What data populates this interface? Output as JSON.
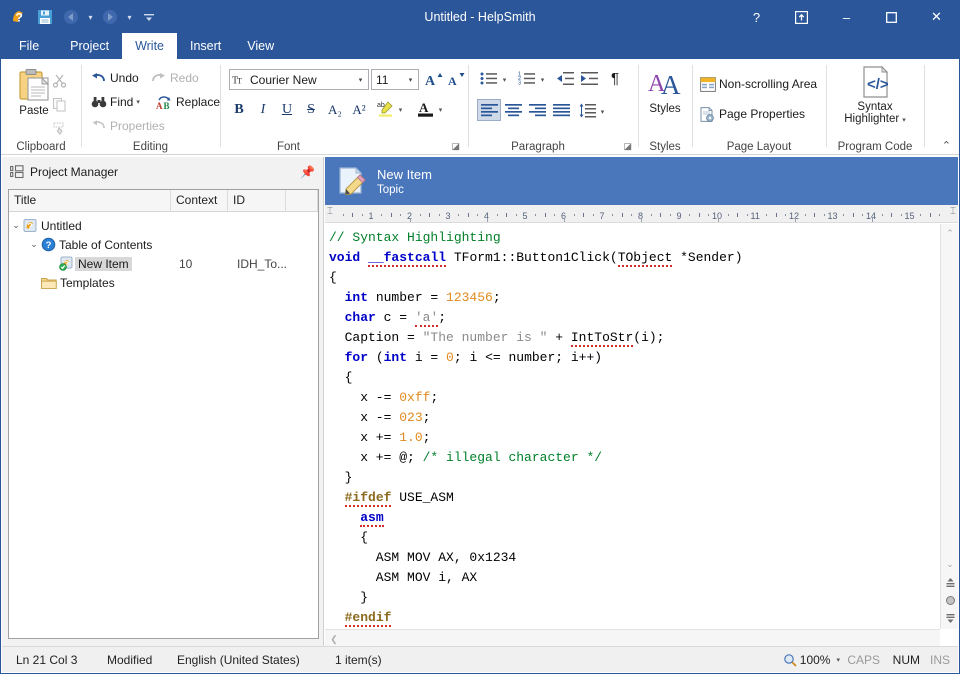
{
  "window": {
    "title": "Untitled - HelpSmith",
    "quick_access": [
      {
        "name": "app-icon",
        "label": "HelpSmith"
      },
      {
        "name": "save-icon",
        "label": "Save"
      },
      {
        "name": "undo-icon",
        "label": "Undo"
      },
      {
        "name": "redo-icon",
        "label": "Redo"
      },
      {
        "name": "customize-qat-icon",
        "label": "Customize Quick Access Toolbar"
      }
    ],
    "controls": [
      {
        "name": "help-button",
        "glyph": "?"
      },
      {
        "name": "ribbon-display-options-button",
        "glyph": "⬒"
      },
      {
        "name": "minimize-button",
        "glyph": "–"
      },
      {
        "name": "maximize-button",
        "glyph": "☐"
      },
      {
        "name": "close-button",
        "glyph": "✕"
      }
    ],
    "accent_color": "#2b579a",
    "header_band_color": "#4a77bb"
  },
  "ribbon": {
    "tabs": [
      {
        "label": "File",
        "active": false
      },
      {
        "label": "Project",
        "active": false
      },
      {
        "label": "Write",
        "active": true
      },
      {
        "label": "Insert",
        "active": false
      },
      {
        "label": "View",
        "active": false
      }
    ],
    "collapse_label": "Collapse the Ribbon",
    "groups": {
      "clipboard": {
        "label": "Clipboard",
        "paste_label": "Paste",
        "cut_label": "Cut",
        "copy_label": "Copy",
        "format_painter_label": "Format Painter"
      },
      "editing": {
        "label": "Editing",
        "undo_label": "Undo",
        "redo_label": "Redo",
        "find_label": "Find",
        "replace_label": "Replace",
        "properties_label": "Properties"
      },
      "font": {
        "label": "Font",
        "font_family_value": "Courier New",
        "font_size_value": "11",
        "grow_font_label": "Grow Font",
        "shrink_font_label": "Shrink Font",
        "bold_label": "B",
        "italic_label": "I",
        "underline_label": "U",
        "strikethrough_label": "S",
        "subscript_label": "A₂",
        "superscript_label": "A²",
        "highlight_label": "Text Highlight Color",
        "font_color_label": "Font Color"
      },
      "paragraph": {
        "label": "Paragraph",
        "bullets_label": "Bullets",
        "numbering_label": "Numbering",
        "decrease_indent_label": "Decrease Indent",
        "increase_indent_label": "Increase Indent",
        "show_marks_label": "Show Formatting Marks",
        "align_left_label": "Align Left",
        "align_center_label": "Center",
        "align_right_label": "Align Right",
        "justify_label": "Justify",
        "line_spacing_label": "Line Spacing"
      },
      "styles": {
        "label": "Styles",
        "styles_button_label": "Styles"
      },
      "page_layout": {
        "label": "Page Layout",
        "non_scrolling_area_label": "Non-scrolling Area",
        "page_properties_label": "Page Properties"
      },
      "program_code": {
        "label": "Program Code",
        "syntax_highlighter_line1": "Syntax",
        "syntax_highlighter_line2": "Highlighter"
      }
    }
  },
  "project_manager": {
    "title": "Project Manager",
    "pin_label": "Auto Hide",
    "columns": [
      "Title",
      "Context",
      "ID"
    ],
    "rows": [
      {
        "label": "Untitled",
        "depth": 0,
        "expanded": true,
        "icon": "project-icon",
        "context": "",
        "id": "",
        "selected": false
      },
      {
        "label": "Table of Contents",
        "depth": 1,
        "expanded": true,
        "icon": "toc-icon",
        "context": "",
        "id": "",
        "selected": false
      },
      {
        "label": "New Item",
        "depth": 2,
        "expanded": null,
        "icon": "topic-icon",
        "context": "10",
        "id": "IDH_To...",
        "selected": true
      },
      {
        "label": "Templates",
        "depth": 1,
        "expanded": null,
        "icon": "folder-icon",
        "context": "",
        "id": "",
        "selected": false
      }
    ]
  },
  "topic_header": {
    "title": "New Item",
    "subtitle": "Topic",
    "icon": "topic-edit-icon"
  },
  "ruler": {
    "numbers": [
      "1",
      "2",
      "3",
      "4",
      "5",
      "6",
      "7",
      "8",
      "9",
      "10",
      "11",
      "12",
      "13",
      "14",
      "15"
    ],
    "left_indent_marker": "⮟",
    "right_indent_marker": "⮟"
  },
  "editor": {
    "lines": [
      [
        {
          "t": "// Syntax Highlighting",
          "c": "cmt"
        }
      ],
      [
        {
          "t": "void",
          "c": "kw"
        },
        {
          "t": " ",
          "c": ""
        },
        {
          "t": "__fastcall",
          "c": "kw sq"
        },
        {
          "t": " TForm1::Button1Click(",
          "c": ""
        },
        {
          "t": "TObject",
          "c": "sq"
        },
        {
          "t": " *Sender)",
          "c": ""
        }
      ],
      [
        {
          "t": "{",
          "c": ""
        }
      ],
      [
        {
          "t": "  ",
          "c": ""
        },
        {
          "t": "int",
          "c": "kw"
        },
        {
          "t": " number = ",
          "c": ""
        },
        {
          "t": "123456",
          "c": "num"
        },
        {
          "t": ";",
          "c": ""
        }
      ],
      [
        {
          "t": "  ",
          "c": ""
        },
        {
          "t": "char",
          "c": "kw"
        },
        {
          "t": " c = ",
          "c": ""
        },
        {
          "t": "'a'",
          "c": "str sq"
        },
        {
          "t": ";",
          "c": ""
        }
      ],
      [
        {
          "t": "  Caption = ",
          "c": ""
        },
        {
          "t": "\"The number is \"",
          "c": "str"
        },
        {
          "t": " + ",
          "c": ""
        },
        {
          "t": "IntToStr",
          "c": "sq"
        },
        {
          "t": "(i);",
          "c": ""
        }
      ],
      [
        {
          "t": "  ",
          "c": ""
        },
        {
          "t": "for",
          "c": "kw"
        },
        {
          "t": " (",
          "c": ""
        },
        {
          "t": "int",
          "c": "kw"
        },
        {
          "t": " i = ",
          "c": ""
        },
        {
          "t": "0",
          "c": "num"
        },
        {
          "t": "; i <= number; i++)",
          "c": ""
        }
      ],
      [
        {
          "t": "  {",
          "c": ""
        }
      ],
      [
        {
          "t": "    x -= ",
          "c": ""
        },
        {
          "t": "0xff",
          "c": "num"
        },
        {
          "t": ";",
          "c": ""
        }
      ],
      [
        {
          "t": "    x -= ",
          "c": ""
        },
        {
          "t": "023",
          "c": "num"
        },
        {
          "t": ";",
          "c": ""
        }
      ],
      [
        {
          "t": "    x += ",
          "c": ""
        },
        {
          "t": "1.0",
          "c": "num"
        },
        {
          "t": ";",
          "c": ""
        }
      ],
      [
        {
          "t": "    x += @; ",
          "c": ""
        },
        {
          "t": "/* illegal character */",
          "c": "cmt"
        }
      ],
      [
        {
          "t": "  }",
          "c": ""
        }
      ],
      [
        {
          "t": "  ",
          "c": ""
        },
        {
          "t": "#ifdef",
          "c": "prep sq"
        },
        {
          "t": " USE_ASM",
          "c": ""
        }
      ],
      [
        {
          "t": "    ",
          "c": ""
        },
        {
          "t": "asm",
          "c": "asmk sq"
        }
      ],
      [
        {
          "t": "    {",
          "c": ""
        }
      ],
      [
        {
          "t": "      ASM MOV AX, 0x1234",
          "c": ""
        }
      ],
      [
        {
          "t": "      ASM MOV i, AX",
          "c": ""
        }
      ],
      [
        {
          "t": "    }",
          "c": ""
        }
      ],
      [
        {
          "t": "  ",
          "c": ""
        },
        {
          "t": "#endif",
          "c": "prep sq"
        }
      ],
      [
        {
          "t": "}",
          "c": ""
        }
      ]
    ],
    "scrollbar": {
      "up_arrow": "▲",
      "down_arrow": "▼",
      "prev_object": "⨏",
      "select_object": "⬤",
      "next_object": "⨏",
      "left_arrow": "❮"
    }
  },
  "statusbar": {
    "position": "Ln 21 Col 3",
    "modified": "Modified",
    "language": "English (United States)",
    "items_count": "1 item(s)",
    "zoom": "100%",
    "caps": "CAPS",
    "num": "NUM",
    "ins": "INS"
  }
}
